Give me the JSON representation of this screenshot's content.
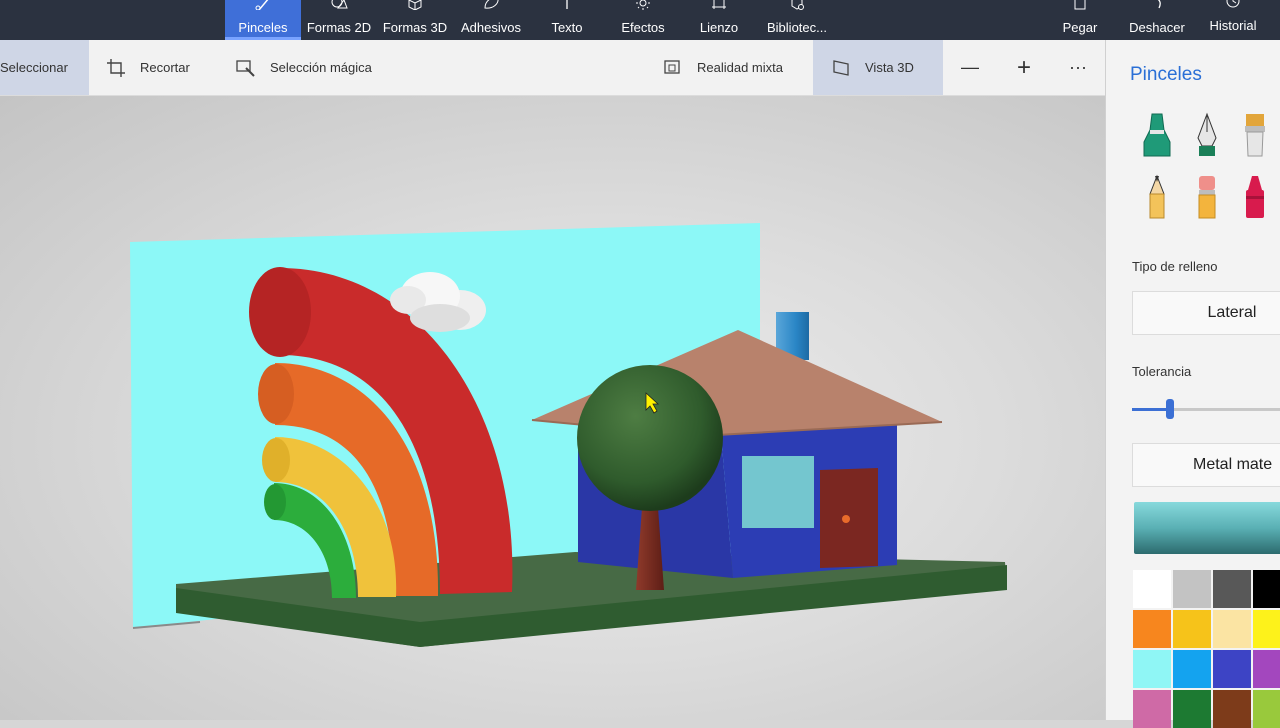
{
  "topbar": {
    "tabs": [
      {
        "label": "Pinceles",
        "icon": "brush-icon",
        "active": true
      },
      {
        "label": "Formas 2D",
        "icon": "shapes-2d-icon"
      },
      {
        "label": "Formas 3D",
        "icon": "cube-icon"
      },
      {
        "label": "Adhesivos",
        "icon": "sticker-icon"
      },
      {
        "label": "Texto",
        "icon": "text-icon"
      },
      {
        "label": "Efectos",
        "icon": "sun-icon"
      },
      {
        "label": "Lienzo",
        "icon": "canvas-icon"
      },
      {
        "label": "Bibliotec...",
        "icon": "library-icon"
      }
    ],
    "actions": [
      {
        "label": "Pegar",
        "icon": "paste-icon"
      },
      {
        "label": "Deshacer",
        "icon": "undo-icon"
      },
      {
        "label": "Historial",
        "icon": "history-icon"
      }
    ]
  },
  "toolbar": {
    "select": "Seleccionar",
    "crop": "Recortar",
    "magic_select": "Selección mágica",
    "mixed_reality": "Realidad mixta",
    "view3d": "Vista 3D",
    "zoom_out": "—",
    "zoom_in": "+",
    "more": "···"
  },
  "panel": {
    "title": "Pinceles",
    "brushes": [
      {
        "name": "marker",
        "color": "#1f9a78"
      },
      {
        "name": "calligraphy-pen",
        "color": "#1a7f58"
      },
      {
        "name": "oil-brush",
        "color": "#e2a53a"
      },
      {
        "name": "pencil",
        "color": "#333333"
      },
      {
        "name": "eraser",
        "color": "#ef8f8a"
      },
      {
        "name": "crayon",
        "color": "#d81b4d"
      }
    ],
    "fill_type_label": "Tipo de relleno",
    "fill_type_value": "Lateral",
    "tolerance_label": "Tolerancia",
    "tolerance_value": 0.24,
    "material_value": "Metal mate",
    "accent": "#2a6fd6",
    "palette": [
      "#ffffff",
      "#c3c3c3",
      "#585858",
      "#000000",
      "#f7861e",
      "#f6c31a",
      "#fbe4a3",
      "#fdf21b",
      "#8ff6f5",
      "#14a3ef",
      "#3d44c5",
      "#a347be",
      "#cf6aa6",
      "#1d7a32",
      "#7d3b1a",
      "#99c93c"
    ]
  }
}
